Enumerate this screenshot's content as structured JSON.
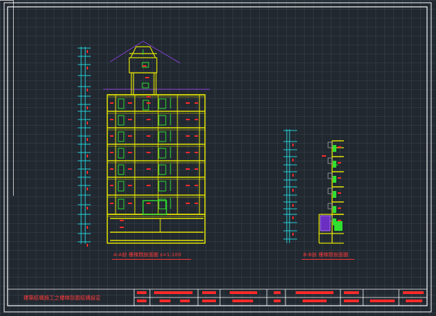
{
  "drawing": {
    "section_1_caption": "A-A剖 樓梯間剖面圖 s=1:100",
    "section_2_caption": "B-B剖 樓梯間剖面圖",
    "title_block": {
      "project_title": "建築結構施工之樓梯剖面結構設定"
    }
  },
  "colors": {
    "background": "#212830",
    "structure": "#e6e600",
    "stairs": "#2fe02f",
    "dimensions": "#22d0d8",
    "annotations": "#ff2a2a",
    "roof_lines": "#8a3fd8",
    "frame": "#ffffff"
  }
}
